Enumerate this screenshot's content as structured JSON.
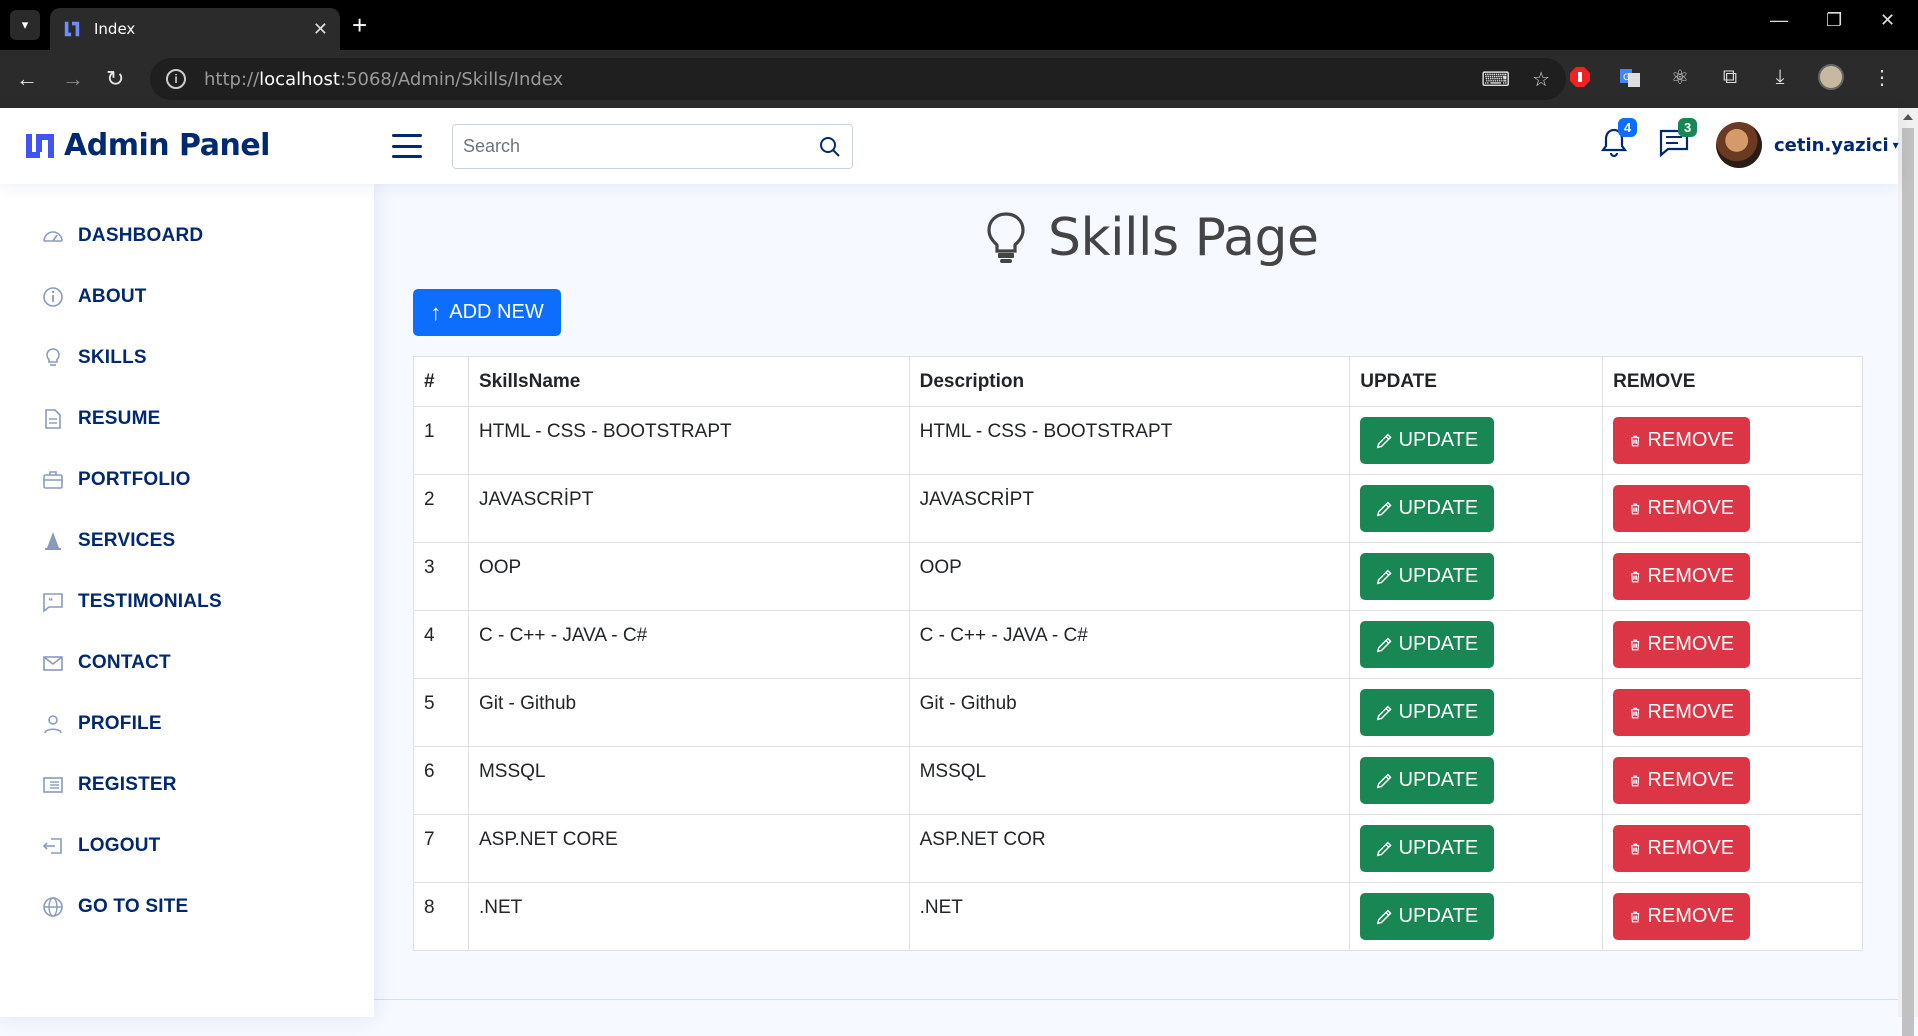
{
  "browser": {
    "tab_title": "Index",
    "url_host": "localhost",
    "url_rest": ":5068/Admin/Skills/Index",
    "url_scheme": "http://"
  },
  "header": {
    "brand": "Admin Panel",
    "search_placeholder": "Search",
    "notifications_count": "4",
    "messages_count": "3",
    "username": "cetin.yazici"
  },
  "sidebar": {
    "items": [
      {
        "label": "DASHBOARD",
        "icon": "speedometer-icon"
      },
      {
        "label": "ABOUT",
        "icon": "info-circle-icon"
      },
      {
        "label": "SKILLS",
        "icon": "lightbulb-icon"
      },
      {
        "label": "RESUME",
        "icon": "file-text-icon"
      },
      {
        "label": "PORTFOLIO",
        "icon": "briefcase-icon"
      },
      {
        "label": "SERVICES",
        "icon": "cone-icon"
      },
      {
        "label": "TESTIMONIALS",
        "icon": "chat-quote-icon"
      },
      {
        "label": "CONTACT",
        "icon": "envelope-icon"
      },
      {
        "label": "PROFILE",
        "icon": "person-icon"
      },
      {
        "label": "REGISTER",
        "icon": "card-list-icon"
      },
      {
        "label": "LOGOUT",
        "icon": "box-arrow-left-icon"
      },
      {
        "label": "GO TO SITE",
        "icon": "globe-icon"
      }
    ]
  },
  "main": {
    "title": "Skills Page",
    "add_new_label": "ADD NEW",
    "table": {
      "headers": [
        "#",
        "SkillsName",
        "Description",
        "UPDATE",
        "REMOVE"
      ],
      "rows": [
        {
          "num": "1",
          "name": "HTML - CSS - BOOTSTRAPT",
          "desc": "HTML - CSS - BOOTSTRAPT"
        },
        {
          "num": "2",
          "name": "JAVASCRİPT",
          "desc": "JAVASCRİPT"
        },
        {
          "num": "3",
          "name": "OOP",
          "desc": "OOP"
        },
        {
          "num": "4",
          "name": "C - C++ - JAVA - C#",
          "desc": "C - C++ - JAVA - C#"
        },
        {
          "num": "5",
          "name": "Git - Github",
          "desc": "Git - Github"
        },
        {
          "num": "6",
          "name": "MSSQL",
          "desc": "MSSQL"
        },
        {
          "num": "7",
          "name": "ASP.NET CORE",
          "desc": "ASP.NET COR"
        },
        {
          "num": "8",
          "name": ".NET",
          "desc": ".NET"
        }
      ],
      "update_label": "UPDATE",
      "remove_label": "REMOVE"
    }
  },
  "colors": {
    "primary": "#0d6efd",
    "success": "#198754",
    "danger": "#dc3545",
    "brand_navy": "#012970"
  }
}
